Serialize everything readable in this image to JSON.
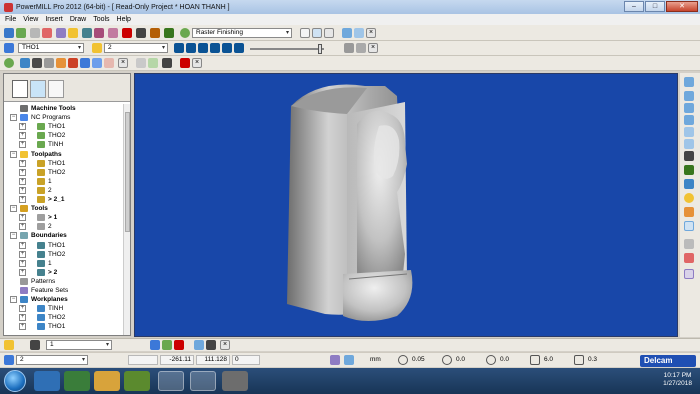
{
  "window": {
    "title": "PowerMILL Pro 2012 (64-bit)   - [ Read-Only Project * HOAN THANH ]",
    "controls": [
      "–",
      "□",
      "✕"
    ]
  },
  "menu": [
    "File",
    "View",
    "Insert",
    "Draw",
    "Tools",
    "Help"
  ],
  "toolbar_strategy": {
    "strategy_value": "Raster Finishing"
  },
  "toolbar_context": {
    "toolpath_combo": "THO1",
    "tool_combo": "2"
  },
  "explorer": {
    "tree": [
      {
        "label": "Machine Tools",
        "level": 0,
        "bold": true,
        "expander": "",
        "icon": "machine"
      },
      {
        "label": "NC Programs",
        "level": 0,
        "bold": false,
        "expander": "−",
        "icon": "nc"
      },
      {
        "label": "THO1",
        "level": 1,
        "bold": false,
        "expander": "+",
        "icon": "nc-item"
      },
      {
        "label": "THO2",
        "level": 1,
        "bold": false,
        "expander": "+",
        "icon": "nc-item"
      },
      {
        "label": "TINH",
        "level": 1,
        "bold": false,
        "expander": "+",
        "icon": "nc-item"
      },
      {
        "label": "Toolpaths",
        "level": 0,
        "bold": true,
        "expander": "−",
        "icon": "toolpath"
      },
      {
        "label": "THO1",
        "level": 1,
        "bold": false,
        "expander": "+",
        "icon": "toolpath-item"
      },
      {
        "label": "THO2",
        "level": 1,
        "bold": false,
        "expander": "+",
        "icon": "toolpath-item"
      },
      {
        "label": "1",
        "level": 1,
        "bold": false,
        "expander": "+",
        "icon": "toolpath-item"
      },
      {
        "label": "2",
        "level": 1,
        "bold": false,
        "expander": "+",
        "icon": "toolpath-item"
      },
      {
        "label": "> 2_1",
        "level": 1,
        "bold": true,
        "expander": "+",
        "icon": "toolpath-item"
      },
      {
        "label": "Tools",
        "level": 0,
        "bold": true,
        "expander": "−",
        "icon": "tool"
      },
      {
        "label": "> 1",
        "level": 1,
        "bold": true,
        "expander": "+",
        "icon": "tool-item"
      },
      {
        "label": "2",
        "level": 1,
        "bold": false,
        "expander": "+",
        "icon": "tool-item"
      },
      {
        "label": "Boundaries",
        "level": 0,
        "bold": true,
        "expander": "−",
        "icon": "boundary"
      },
      {
        "label": "THO1",
        "level": 1,
        "bold": false,
        "expander": "+",
        "icon": "boundary-item"
      },
      {
        "label": "THO2",
        "level": 1,
        "bold": false,
        "expander": "+",
        "icon": "boundary-item"
      },
      {
        "label": "1",
        "level": 1,
        "bold": false,
        "expander": "+",
        "icon": "boundary-item"
      },
      {
        "label": "> 2",
        "level": 1,
        "bold": true,
        "expander": "+",
        "icon": "boundary-item"
      },
      {
        "label": "Patterns",
        "level": 0,
        "bold": false,
        "expander": "",
        "icon": "pattern"
      },
      {
        "label": "Feature Sets",
        "level": 0,
        "bold": false,
        "expander": "",
        "icon": "feature"
      },
      {
        "label": "Workplanes",
        "level": 0,
        "bold": true,
        "expander": "−",
        "icon": "workplane"
      },
      {
        "label": "TINH",
        "level": 1,
        "bold": false,
        "expander": "+",
        "icon": "workplane-item"
      },
      {
        "label": "THO2",
        "level": 1,
        "bold": false,
        "expander": "+",
        "icon": "workplane-item"
      },
      {
        "label": "THO1",
        "level": 1,
        "bold": false,
        "expander": "+",
        "icon": "workplane-item"
      }
    ]
  },
  "status": {
    "tool_combo": "1",
    "workplane_combo": "2",
    "coord_x": "-261.11",
    "coord_y": "111.128",
    "coord_z": "0",
    "units": "mm",
    "tolerance": "0.05",
    "thickness": "0.0",
    "axial_thickness": "0.0",
    "stepover": "6.0",
    "stepdown": "0.3",
    "brand": "Delcam"
  },
  "taskbar": {
    "time": "10:17 PM",
    "date": "1/27/2018"
  },
  "colors": {
    "viewport_bg": "#1847a9",
    "model_light": "#d8d8d8",
    "model_dark": "#8c8c8c"
  }
}
